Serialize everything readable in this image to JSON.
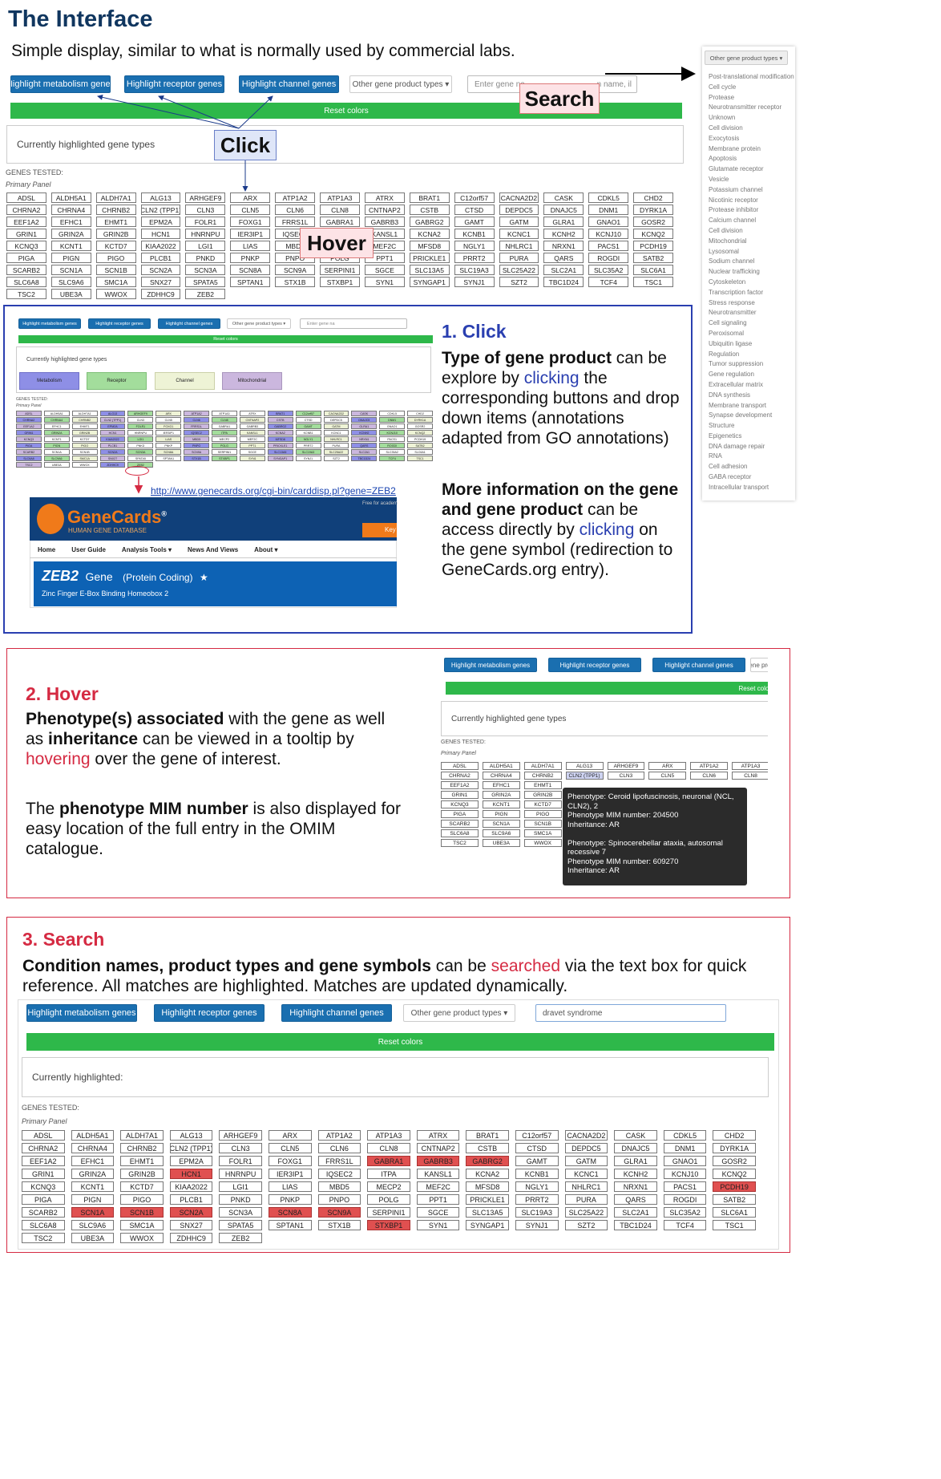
{
  "header": {
    "title": "The Interface",
    "subtitle": "Simple display, similar to what is normally used by commercial labs."
  },
  "toolbar": {
    "metabolism": "Highlight metabolism genes",
    "receptor": "Highlight receptor genes",
    "channel": "Highlight channel genes",
    "other": "Other gene product types ▾",
    "search_placeholder_left": "Enter gene na",
    "search_placeholder_right": "n name, il",
    "reset": "Reset colors"
  },
  "panel": {
    "currently": "Currently highlighted gene types",
    "genes_tested": "GENES TESTED:",
    "primary_panel": "Primary Panel"
  },
  "callouts": {
    "search": "Search",
    "click": "Click",
    "hover": "Hover"
  },
  "genes_top": [
    "ADSL",
    "ALDH5A1",
    "ALDH7A1",
    "ALG13",
    "ARHGEF9",
    "ARX",
    "ATP1A2",
    "ATP1A3",
    "ATRX",
    "BRAT1",
    "C12orf57",
    "CACNA2D2",
    "CASK",
    "CDKL5",
    "CHD2",
    "CHRNA2",
    "CHRNA4",
    "CHRNB2",
    "CLN2 (TPP1)",
    "CLN3",
    "CLN5",
    "CLN6",
    "CLN8",
    "CNTNAP2",
    "CSTB",
    "CTSD",
    "DEPDC5",
    "DNAJC5",
    "DNM1",
    "DYRK1A",
    "EEF1A2",
    "EFHC1",
    "EHMT1",
    "EPM2A",
    "FOLR1",
    "FOXG1",
    "FRRS1L",
    "GABRA1",
    "GABRB3",
    "GABRG2",
    "GAMT",
    "GATM",
    "GLRA1",
    "GNAO1",
    "GOSR2",
    "GRIN1",
    "GRIN2A",
    "GRIN2B",
    "HCN1",
    "HNRNPU",
    "IER3IP1",
    "IQSEC2",
    "ITPA",
    "KANSL1",
    "KCNA2",
    "KCNB1",
    "KCNC1",
    "KCNH2",
    "KCNJ10",
    "KCNQ2",
    "KCNQ3",
    "KCNT1",
    "KCTD7",
    "KIAA2022",
    "LGI1",
    "LIAS",
    "MBD5",
    "MECP2",
    "MEF2C",
    "MFSD8",
    "NGLY1",
    "NHLRC1",
    "NRXN1",
    "PACS1",
    "PCDH19",
    "PIGA",
    "PIGN",
    "PIGO",
    "PLCB1",
    "PNKD",
    "PNKP",
    "PNPO",
    "POLG",
    "PPT1",
    "PRICKLE1",
    "PRRT2",
    "PURA",
    "QARS",
    "ROGDI",
    "SATB2",
    "SCARB2",
    "SCN1A",
    "SCN1B",
    "SCN2A",
    "SCN3A",
    "SCN8A",
    "SCN9A",
    "SERPINI1",
    "SGCE",
    "SLC13A5",
    "SLC19A3",
    "SLC25A22",
    "SLC2A1",
    "SLC35A2",
    "SLC6A1",
    "SLC6A8",
    "SLC9A6",
    "SMC1A",
    "SNX27",
    "SPATA5",
    "SPTAN1",
    "STX1B",
    "STXBP1",
    "SYN1",
    "SYNGAP1",
    "SYNJ1",
    "SZT2",
    "TBC1D24",
    "TCF4",
    "TSC1",
    "TSC2",
    "UBE3A",
    "WWOX",
    "ZDHHC9",
    "ZEB2"
  ],
  "dropdown": {
    "button": "Other gene product types ▾",
    "items": [
      "Post-translational modification",
      "Cell cycle",
      "Protease",
      "Neurotransmitter receptor",
      "Unknown",
      "Cell division",
      "Exocytosis",
      "Membrane protein",
      "Apoptosis",
      "Glutamate receptor",
      "Vesicle",
      "Potassium channel",
      "Nicotinic receptor",
      "Protease inhibitor",
      "Calcium channel",
      "Cell division",
      "Mitochondrial",
      "Lysosomal",
      "Sodium channel",
      "Nuclear trafficking",
      "Cytoskeleton",
      "Transcription factor",
      "Stress response",
      "Neurotransmitter",
      "Cell signaling",
      "Peroxisomal",
      "Ubiquitin ligase",
      "Regulation",
      "Tumor suppression",
      "Gene regulation",
      "Extracellular matrix",
      "DNA synthesis",
      "Membrane transport",
      "Synapse development",
      "Structure",
      "Epigenetics",
      "DNA damage repair",
      "RNA",
      "Cell adhesion",
      "GABA receptor",
      "Intracellular transport"
    ]
  },
  "section1": {
    "heading": "1. Click",
    "p1_bold": "Type of gene product",
    "p1_a": " can be explore by ",
    "p1_link": "clicking",
    "p1_b": " the corresponding buttons and drop down items (annotations adapted from GO annotations)",
    "p2_bold": "More information on the gene and gene product",
    "p2_a": " can be access directly by ",
    "p2_link": "clicking",
    "p2_b": " on the gene symbol (redirection to GeneCards.org entry).",
    "url": "http://www.genecards.org/cgi-bin/carddisp.pl?gene=ZEB2",
    "legend": [
      "Metabolism",
      "Receptor",
      "Channel",
      "Mitochondrial"
    ],
    "genecards": {
      "logo": "GeneCards",
      "reg": "®",
      "tagline": "HUMAN GENE DATABASE",
      "free": "Free for academ",
      "key": "Key",
      "nav": [
        "Home",
        "User Guide",
        "Analysis Tools ▾",
        "News And Views",
        "About ▾"
      ],
      "gene": "ZEB2",
      "gene_word": "Gene",
      "coding": "(Protein Coding)",
      "star": "★",
      "desc": "Zinc Finger E-Box Binding Homeobox 2"
    }
  },
  "section2": {
    "heading": "2. Hover",
    "p1_bold": "Phenotype(s) associated",
    "p1_a": " with the gene as well as ",
    "p1_bold2": "inheritance",
    "p1_b": " can be viewed in a tooltip by ",
    "p1_link": "hovering",
    "p1_c": " over the gene of interest.",
    "p2_a": "The ",
    "p2_bold": "phenotype MIM number",
    "p2_b": " is also displayed for easy location of the full entry in the OMIM catalogue.",
    "tooltip": [
      "Phenotype: Ceroid lipofuscinosis, neuronal (NCL,",
      "CLN2), 2",
      "Phenotype MIM number: 204500",
      "Inheritance: AR",
      "",
      "Phenotype: Spinocerebellar ataxia, autosomal",
      "recessive 7",
      "Phenotype MIM number: 609270",
      "Inheritance: AR"
    ],
    "mini_genes": [
      "ADSL",
      "ALDH5A1",
      "ALDH7A1",
      "ALG13",
      "ARHGEF9",
      "ARX",
      "ATP1A2",
      "ATP1A3",
      "CHRNA2",
      "CHRNA4",
      "CHRNB2",
      "CLN2 (TPP1)",
      "CLN3",
      "CLN5",
      "CLN6",
      "CLN8",
      "EEF1A2",
      "EFHC1",
      "EHMT1",
      "",
      "",
      "",
      "",
      "",
      "GRIN1",
      "GRIN2A",
      "GRIN2B",
      "",
      "",
      "",
      "",
      "",
      "KCNQ3",
      "KCNT1",
      "KCTD7",
      "",
      "",
      "",
      "",
      "",
      "PIGA",
      "PIGN",
      "PIGO",
      "",
      "",
      "",
      "",
      "",
      "SCARB2",
      "SCN1A",
      "SCN1B",
      "",
      "",
      "",
      "",
      "",
      "SLC6A8",
      "SLC9A6",
      "SMC1A",
      "",
      "",
      "",
      "",
      "",
      "TSC2",
      "UBE3A",
      "WWOX",
      "",
      "",
      "",
      "",
      ""
    ]
  },
  "section3": {
    "heading": "3. Search",
    "p1_bold": "Condition names, product types and gene symbols",
    "p1_a": " can be ",
    "p1_link": "searched",
    "p1_b": " via the text box for quick reference. All matches are highlighted. Matches are updated dynamically.",
    "search_value": "dravet syndrome",
    "currently": "Currently highlighted:",
    "highlighted": [
      "HCN1",
      "GABRA1",
      "GABRB3",
      "GABRG2",
      "PCDH19",
      "SCN1A",
      "SCN1B",
      "SCN2A",
      "SCN8A",
      "SCN9A",
      "STXBP1"
    ]
  },
  "colors": {
    "brand_blue": "#1a6fb0",
    "green": "#2eb84a",
    "highlight_red": "#e05050",
    "section2_border": "#d52a42",
    "section1_border": "#2a3fb0"
  }
}
